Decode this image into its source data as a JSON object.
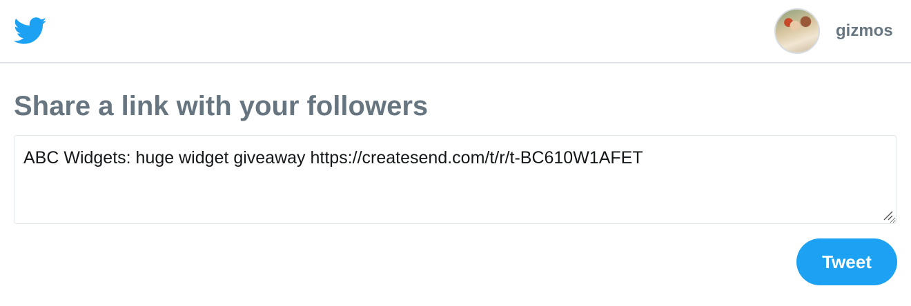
{
  "header": {
    "logo_icon": "twitter-bird-icon",
    "brand_color": "#1da1f2",
    "avatar_icon": "user-avatar",
    "username": "gizmos"
  },
  "main": {
    "heading": "Share a link with your followers",
    "tweet_text": "ABC Widgets: huge widget giveaway https://createsend.com/t/r/t-BC610W1AFET",
    "tweet_button_label": "Tweet"
  }
}
